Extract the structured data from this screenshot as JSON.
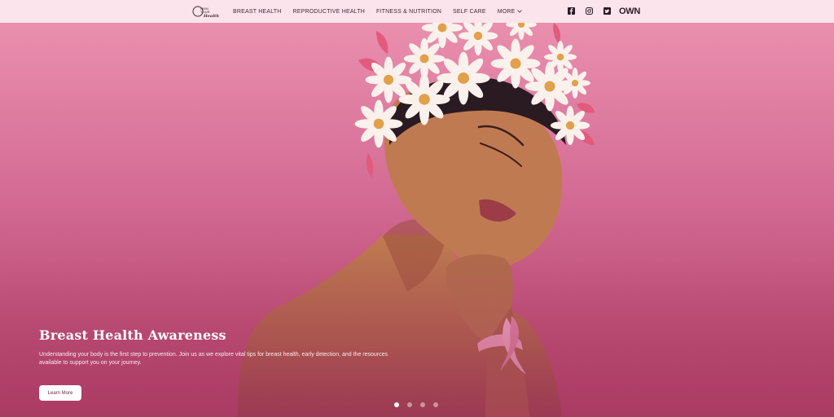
{
  "header": {
    "logo_lines": [
      "OWN",
      "YOUR",
      "Health"
    ],
    "nav": [
      {
        "label": "BREAST HEALTH"
      },
      {
        "label": "REPRODUCTIVE HEALTH"
      },
      {
        "label": "FITNESS & NUTRITION"
      },
      {
        "label": "SELF CARE"
      },
      {
        "label": "MORE"
      }
    ],
    "social_icons": [
      "facebook-icon",
      "instagram-icon",
      "twitter-icon"
    ],
    "brand": "OWN"
  },
  "hero": {
    "title": "Breast Health Awareness",
    "text": "Understanding your body is the first step to prevention. Join us as we explore vital tips for breast health, early detection, and the resources available to support you on your journey.",
    "cta_label": "Learn More",
    "slides": 4,
    "active_slide": 1
  },
  "colors": {
    "topbar": "#fbe4ec",
    "hero_top": "#ea8fae",
    "hero_bottom": "#ad3f68",
    "skin": "#b86f4a",
    "flower": "#fbf1ec"
  }
}
